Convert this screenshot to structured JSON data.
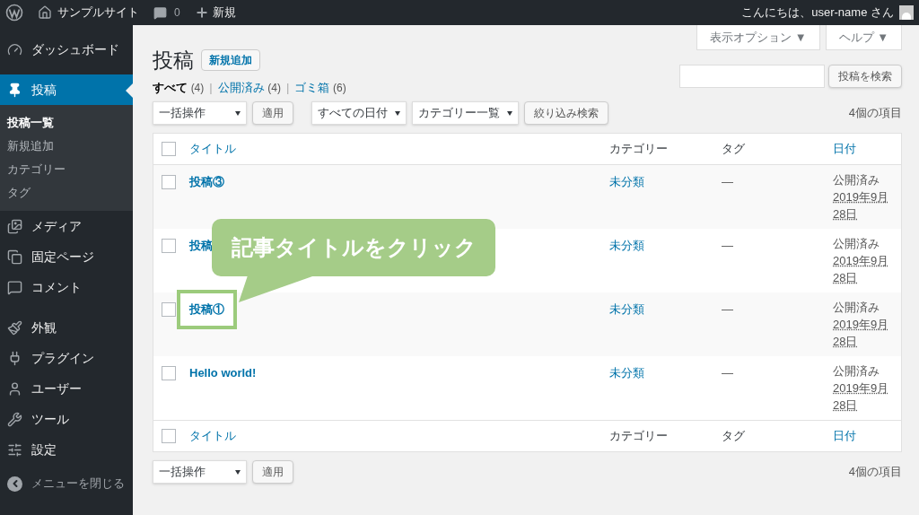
{
  "admin_bar": {
    "site_name": "サンプルサイト",
    "comments": "0",
    "new": "新規",
    "greeting": "こんにちは、user-name さん"
  },
  "sidebar": {
    "groups": [
      [
        {
          "label": "ダッシュボード",
          "selected": false
        }
      ],
      [
        {
          "label": "投稿",
          "selected": true,
          "children": [
            {
              "label": "投稿一覧",
              "selected": true
            },
            {
              "label": "新規追加",
              "selected": false
            },
            {
              "label": "カテゴリー",
              "selected": false
            },
            {
              "label": "タグ",
              "selected": false
            }
          ]
        },
        {
          "label": "メディア",
          "selected": false
        },
        {
          "label": "固定ページ",
          "selected": false
        },
        {
          "label": "コメント",
          "selected": false
        }
      ],
      [
        {
          "label": "外観",
          "selected": false
        },
        {
          "label": "プラグイン",
          "selected": false
        },
        {
          "label": "ユーザー",
          "selected": false
        },
        {
          "label": "ツール",
          "selected": false
        },
        {
          "label": "設定",
          "selected": false
        }
      ]
    ],
    "collapse": "メニューを閉じる"
  },
  "screen_tabs": [
    "表示オプション ▼",
    "ヘルプ ▼"
  ],
  "page_title": "投稿",
  "add_new": "新規追加",
  "filters": [
    {
      "label": "すべて",
      "count": "(4)",
      "selected": true
    },
    {
      "separator": "|",
      "label": "公開済み",
      "count": "(4)",
      "selected": false
    },
    {
      "separator": "|",
      "label": "ゴミ箱",
      "count": "(6)",
      "selected": false
    }
  ],
  "search_button": "投稿を検索",
  "top_actions": {
    "bulk": "一括操作",
    "apply": "適用",
    "dates": "すべての日付",
    "categories": "カテゴリー一覧",
    "filter": "絞り込み検索",
    "count": "4個の項目"
  },
  "table": {
    "columns": [
      "タイトル",
      "カテゴリー",
      "タグ",
      "日付"
    ],
    "header_checked": false,
    "rows": [
      {
        "checked": false,
        "title": "投稿③",
        "category": "未分類",
        "tags": "—",
        "status": "公開済み",
        "date": "2019年9月28日",
        "highlighted": false
      },
      {
        "checked": false,
        "title": "投稿",
        "category": "未分類",
        "tags": "—",
        "status": "公開済み",
        "date": "2019年9月28日",
        "highlighted": false
      },
      {
        "checked": false,
        "title": "投稿①",
        "category": "未分類",
        "tags": "—",
        "status": "公開済み",
        "date": "2019年9月28日",
        "highlighted": true
      },
      {
        "checked": false,
        "title": "Hello world!",
        "category": "未分類",
        "tags": "—",
        "status": "公開済み",
        "date": "2019年9月28日",
        "highlighted": false
      }
    ],
    "footer_columns": [
      "タイトル",
      "カテゴリー",
      "タグ",
      "日付"
    ],
    "footer_checked": false
  },
  "bottom_actions": {
    "bulk": "一括操作",
    "apply": "適用",
    "count": "4個の項目"
  },
  "callout": {
    "text": "記事タイトルをクリック"
  }
}
